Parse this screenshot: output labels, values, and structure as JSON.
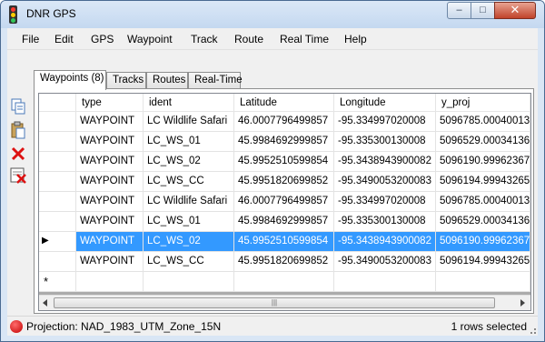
{
  "window": {
    "title": "DNR GPS",
    "min_glyph": "‒",
    "max_glyph": "□",
    "close_glyph": "✕"
  },
  "menu": [
    "File",
    "Edit",
    "GPS",
    "Waypoint",
    "Track",
    "Route",
    "Real Time",
    "Help"
  ],
  "tabs": [
    "Waypoints (8)",
    "Tracks",
    "Routes",
    "Real-Time"
  ],
  "toolbar": [
    "copy-icon",
    "paste-icon",
    "delete-icon",
    "delete-all-icon"
  ],
  "grid": {
    "columns": [
      "type",
      "ident",
      "Latitude",
      "Longitude",
      "y_proj"
    ],
    "rows": [
      [
        "WAYPOINT",
        "LC Wildlife Safari",
        "46.0007796499857",
        "-95.334997020008",
        "5096785.00040013"
      ],
      [
        "WAYPOINT",
        "LC_WS_01",
        "45.9984692999857",
        "-95.335300130008",
        "5096529.00034136"
      ],
      [
        "WAYPOINT",
        "LC_WS_02",
        "45.9952510599854",
        "-95.3438943900082",
        "5096190.99962367"
      ],
      [
        "WAYPOINT",
        "LC_WS_CC",
        "45.9951820699852",
        "-95.3490053200083",
        "5096194.99943265"
      ],
      [
        "WAYPOINT",
        "LC Wildlife Safari",
        "46.0007796499857",
        "-95.334997020008",
        "5096785.00040013"
      ],
      [
        "WAYPOINT",
        "LC_WS_01",
        "45.9984692999857",
        "-95.335300130008",
        "5096529.00034136"
      ],
      [
        "WAYPOINT",
        "LC_WS_02",
        "45.9952510599854",
        "-95.3438943900082",
        "5096190.99962367"
      ],
      [
        "WAYPOINT",
        "LC_WS_CC",
        "45.9951820699852",
        "-95.3490053200083",
        "5096194.99943265"
      ]
    ],
    "selected_row_number": 7,
    "new_row_glyph": "*",
    "current_row_glyph": "▶"
  },
  "status": {
    "projection": "Projection: NAD_1983_UTM_Zone_15N",
    "selection": "1 rows selected",
    "status_color": "#d40000"
  },
  "colors": {
    "selection": "#3399ff",
    "title_bar": "#c4d8f0"
  }
}
